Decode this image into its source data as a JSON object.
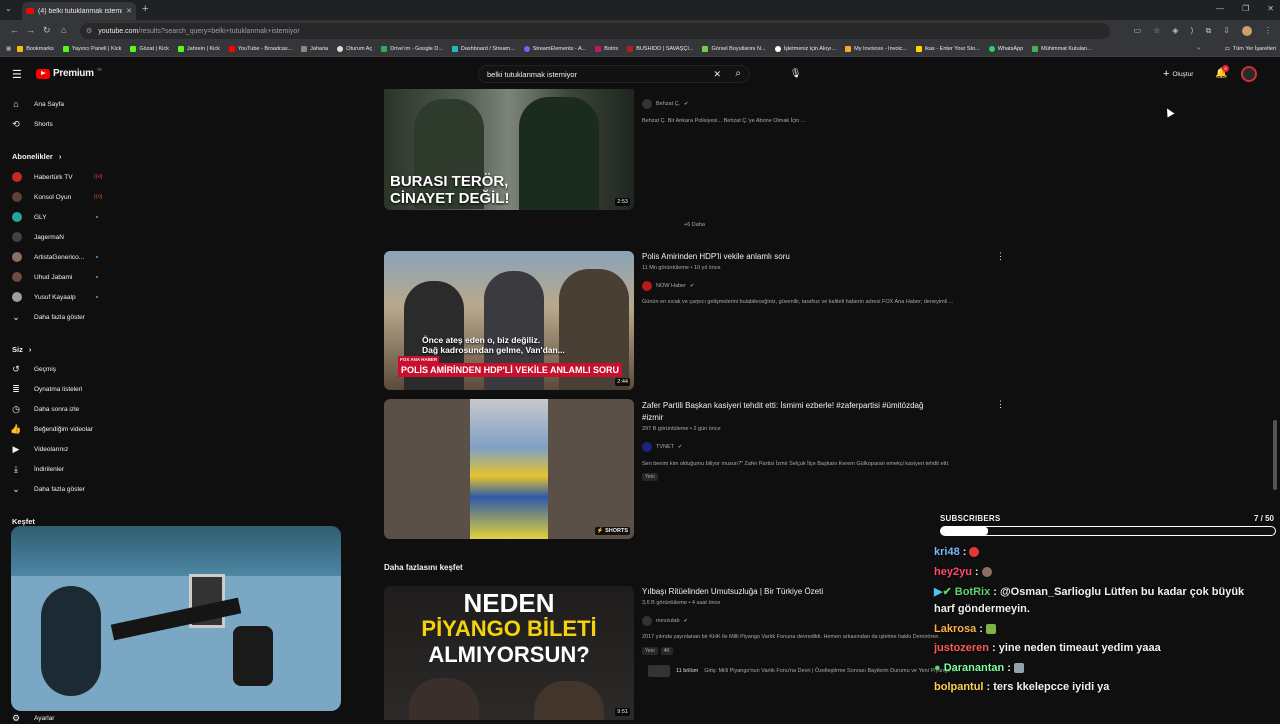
{
  "browser": {
    "tab_title": "(4) belki tutuklanmak istemiyor",
    "url_domain": "youtube.com",
    "url_path": "/results?search_query=belki+tutuklanmak+istemiyor",
    "bookmarks": [
      "Bookmarks",
      "Yayıncı Paneli | Kick",
      "Gözat | Kick",
      "Jahrein | Kick",
      "YouTube - Broadcas...",
      "Jaharia",
      "Oturum Aç",
      "Drive'ım - Google D...",
      "Dashboard / Stream...",
      "StreamElements - A...",
      "Botrix",
      "BUSHIDO | SAVAŞÇI...",
      "Görsel Boyutlarını N...",
      "İşletmeniz için Akıyı...",
      "My Invoices - Invoic...",
      "ikas - Enter Your Sto...",
      "WhatsApp",
      "Mühimmat Kutuları..."
    ],
    "all_bookmarks": "Tüm Yer İşaretleri"
  },
  "yt": {
    "logo_text": "Premium",
    "logo_sup": "TR",
    "search_value": "belki tutuklanmak istemiyor",
    "create_label": "Oluştur",
    "notif_count": "4"
  },
  "sidebar": {
    "home": "Ana Sayfa",
    "shorts": "Shorts",
    "subs_head": "Abonelikler",
    "subs": [
      "Habertürk TV",
      "Konsol Oyun",
      "GLY",
      "JagermaN",
      "ArtistaGenerico...",
      "Uhud Jabami",
      "Yusuf Kayaalp"
    ],
    "show_more": "Daha fazla göster",
    "you_head": "Siz",
    "you_items": [
      "Geçmiş",
      "Oynatma listeleri",
      "Daha sonra izle",
      "Beğendiğim videolar",
      "Videolarınız",
      "İndirilenler"
    ],
    "show_more2": "Daha fazla göster",
    "explore_head": "Keşfet",
    "settings": "Ayarlar"
  },
  "results": {
    "r0": {
      "thumb_text1": "BURASI TERÖR,",
      "thumb_text2": "CİNAYET DEĞİL!",
      "duration": "2:53",
      "channel": "Behzat Ç.",
      "desc": "Behzat Ç. Bir Ankara Polisiyesi... Behzat Ç.'ye Abone Olmak İçin ..."
    },
    "more": "+6 Daha",
    "r1": {
      "title": "Polis Amirinden HDP'li vekile anlamlı soru",
      "meta": "11 Mn görüntüleme • 10 yıl önce",
      "channel": "NOW Haber",
      "desc": "Günün en sıcak ve çarpıcı gelişmelerini bulabileceğiniz, güvenilir, tarafsız ve kaliteli haberin adresi FOX Ana Haber; deneyimli ...",
      "duration": "2:44",
      "cap1": "Önce ateş eden o, biz değiliz.",
      "cap2": "Dağ kadrosundan gelme, Van'dan...",
      "brand": "FOX ANA HABER",
      "banner": "POLİS AMİRİNDEN HDP'Lİ VEKİLE ANLAMLI SORU"
    },
    "r2": {
      "title": "Zafer Partili Başkan kasiyeri tehdit etti: İsmimi ezberle! #zaferpartisi #ümitözdağ",
      "title2": "#izmir",
      "meta": "297 B görüntüleme • 2 gün önce",
      "channel": "TVNET",
      "desc": "Sen benim kim olduğumu biliyor musun?\" Zafer Partisi İzmir Selçuk İlçe Başkanı Kerem Gülkoparan emekçi kasiyeri tehdit etti.",
      "badge": "Yeni",
      "shorts": "SHORTS"
    },
    "explore_title": "Daha fazlasını keşfet",
    "r3": {
      "title": "Yılbaşı Ritüelinden Umutsuzluğa | Bir Türkiye Özeti",
      "meta": "3,6 B görüntüleme • 4 saat önce",
      "channel": "mevzulab",
      "desc": "2017 yılında yayınlanan bir KHK ile Milli Piyango Varlık Fonuna devredildi. Hemen arkasından da işletme hakkı Demirören ...",
      "badge1": "Yeni",
      "badge2": "4K",
      "chapter_label": "11 bölüm",
      "chapter_text": "Giriş: Milli Piyango'nun Varlık Fonu'na Devri | Özelleştirme Sonrası Bayilerin Durumu ve Yeni Piyango ...",
      "thumb1": "NEDEN",
      "thumb2": "PİYANGO BİLETİ",
      "thumb3": "ALMIYORSUN?",
      "duration": "9:51"
    }
  },
  "overlay": {
    "subs_label": "SUBSCRIBERS",
    "subs_count": "7 / 50",
    "subs_progress": 0.14,
    "chat": [
      {
        "user": "kri48",
        "color": "#7cb7ff",
        "text": ""
      },
      {
        "user": "hey2yu",
        "color": "#ff4d6a",
        "text": ""
      },
      {
        "user": "BotRix",
        "color": "#5dd26e",
        "text": "@Osman_Sarlioglu Lütfen bu kadar çok büyük"
      },
      {
        "user": "",
        "color": "#ffffff",
        "text": "harf göndermeyin."
      },
      {
        "user": "Lakrosa",
        "color": "#ffb347",
        "text": ""
      },
      {
        "user": "justozeren",
        "color": "#ff5a5a",
        "text": "yine neden timeaut yedim yaaa"
      },
      {
        "user": "Daranantan",
        "color": "#7dff9a",
        "text": ""
      },
      {
        "user": "bolpantul",
        "color": "#ffd24d",
        "text": "ters kkelepcce iyidi ya"
      }
    ]
  }
}
